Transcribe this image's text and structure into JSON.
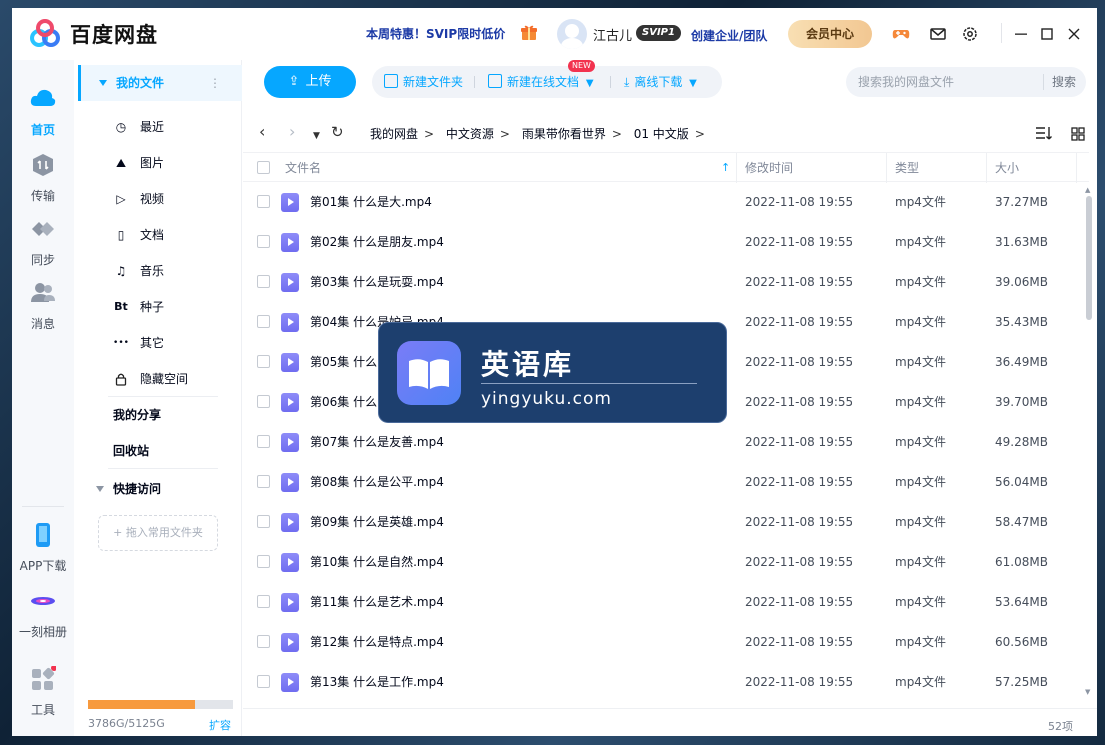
{
  "app": {
    "name": "百度网盘"
  },
  "titlebar": {
    "promo": "本周特惠！SVIP限时低价",
    "username": "江古儿",
    "vip_badge": "SVIP1",
    "biz_link": "创建企业/团队",
    "vip_center": "会员中心"
  },
  "leftnav": {
    "items": [
      {
        "label": "首页",
        "icon": "cloud-icon"
      },
      {
        "label": "传输",
        "icon": "transfer-icon"
      },
      {
        "label": "同步",
        "icon": "sync-icon"
      },
      {
        "label": "消息",
        "icon": "message-icon"
      }
    ],
    "bottom": [
      {
        "label": "APP下载",
        "icon": "phone-icon"
      },
      {
        "label": "一刻相册",
        "icon": "album-icon"
      },
      {
        "label": "工具",
        "icon": "tools-icon"
      }
    ]
  },
  "sidebar": {
    "my_files": "我的文件",
    "categories": [
      {
        "label": "最近",
        "icon": "clock-icon",
        "glyph": "◷"
      },
      {
        "label": "图片",
        "icon": "image-icon",
        "glyph": "⛰"
      },
      {
        "label": "视频",
        "icon": "video-icon",
        "glyph": "▷"
      },
      {
        "label": "文档",
        "icon": "document-icon",
        "glyph": "▯"
      },
      {
        "label": "音乐",
        "icon": "headphones-icon",
        "glyph": "♫"
      },
      {
        "label": "种子",
        "icon": "torrent-icon",
        "glyph": "Bt"
      },
      {
        "label": "其它",
        "icon": "more-icon",
        "glyph": "•••"
      },
      {
        "label": "隐藏空间",
        "icon": "lock-icon",
        "glyph": "🔒"
      }
    ],
    "my_share": "我的分享",
    "recycle": "回收站",
    "quick_access": "快捷访问",
    "drop_hint": "+ 拖入常用文件夹",
    "storage": {
      "used_gb": 3786,
      "total_gb": 5125,
      "text": "3786G/5125G",
      "used_fraction": 0.739
    },
    "expand": "扩容"
  },
  "toolbar": {
    "upload": "上传",
    "new_folder": "新建文件夹",
    "new_online_doc": "新建在线文档",
    "new_badge": "NEW",
    "offline_download": "离线下载",
    "search_placeholder": "搜索我的网盘文件",
    "search_button": "搜索"
  },
  "breadcrumb": [
    "我的网盘",
    "中文资源",
    "雨果带你看世界",
    "01 中文版"
  ],
  "table": {
    "headers": {
      "name": "文件名",
      "modified": "修改时间",
      "type": "类型",
      "size": "大小"
    },
    "rows": [
      {
        "name": "第01集 什么是大.mp4",
        "modified": "2022-11-08 19:55",
        "type": "mp4文件",
        "size": "37.27MB"
      },
      {
        "name": "第02集 什么是朋友.mp4",
        "modified": "2022-11-08 19:55",
        "type": "mp4文件",
        "size": "31.63MB"
      },
      {
        "name": "第03集 什么是玩耍.mp4",
        "modified": "2022-11-08 19:55",
        "type": "mp4文件",
        "size": "39.06MB"
      },
      {
        "name": "第04集 什么是妒忌.mp4",
        "modified": "2022-11-08 19:55",
        "type": "mp4文件",
        "size": "35.43MB"
      },
      {
        "name": "第05集 什么",
        "modified": "2022-11-08 19:55",
        "type": "mp4文件",
        "size": "36.49MB"
      },
      {
        "name": "第06集 什么",
        "modified": "2022-11-08 19:55",
        "type": "mp4文件",
        "size": "39.70MB"
      },
      {
        "name": "第07集 什么是友善.mp4",
        "modified": "2022-11-08 19:55",
        "type": "mp4文件",
        "size": "49.28MB"
      },
      {
        "name": "第08集 什么是公平.mp4",
        "modified": "2022-11-08 19:55",
        "type": "mp4文件",
        "size": "56.04MB"
      },
      {
        "name": "第09集 什么是英雄.mp4",
        "modified": "2022-11-08 19:55",
        "type": "mp4文件",
        "size": "58.47MB"
      },
      {
        "name": "第10集 什么是自然.mp4",
        "modified": "2022-11-08 19:55",
        "type": "mp4文件",
        "size": "61.08MB"
      },
      {
        "name": "第11集 什么是艺术.mp4",
        "modified": "2022-11-08 19:55",
        "type": "mp4文件",
        "size": "53.64MB"
      },
      {
        "name": "第12集 什么是特点.mp4",
        "modified": "2022-11-08 19:55",
        "type": "mp4文件",
        "size": "60.56MB"
      },
      {
        "name": "第13集 什么是工作.mp4",
        "modified": "2022-11-08 19:55",
        "type": "mp4文件",
        "size": "57.25MB"
      }
    ],
    "count": "52项"
  },
  "watermark": {
    "title": "英语库",
    "url": "yingyuku.com"
  },
  "colors": {
    "accent": "#06a7ff",
    "vip_gold": "#f2c792",
    "storage_bar": "#f79a3e",
    "video_icon": "#7b79f5"
  }
}
